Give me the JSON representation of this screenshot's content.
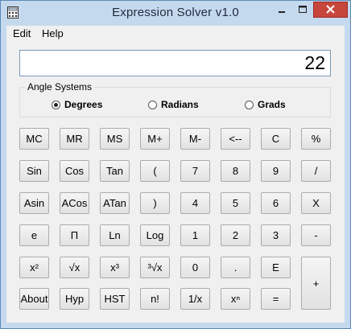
{
  "window": {
    "title": "Expression Solver v1.0"
  },
  "menu": [
    "Edit",
    "Help"
  ],
  "display": {
    "value": "22"
  },
  "angle_systems": {
    "label": "Angle Systems",
    "options": [
      {
        "label": "Degrees",
        "selected": true
      },
      {
        "label": "Radians",
        "selected": false
      },
      {
        "label": "Grads",
        "selected": false
      }
    ]
  },
  "buttons": {
    "rows": [
      [
        "MC",
        "MR",
        "MS",
        "M+",
        "M-",
        "<--",
        "C",
        "%"
      ],
      [
        "Sin",
        "Cos",
        "Tan",
        "(",
        "7",
        "8",
        "9",
        "/"
      ],
      [
        "Asin",
        "ACos",
        "ATan",
        ")",
        "4",
        "5",
        "6",
        "X"
      ],
      [
        "e",
        "Π",
        "Ln",
        "Log",
        "1",
        "2",
        "3",
        "-"
      ],
      [
        "x²",
        "√x",
        "x³",
        "³√x",
        "0",
        ".",
        "E"
      ],
      [
        "About",
        "Hyp",
        "HST",
        "n!",
        "1/x",
        "xⁿ",
        "="
      ]
    ],
    "plus": "+"
  },
  "colors": {
    "close_button": "#c7463c",
    "titlebar": "#c5d9ee",
    "client": "#f0f0f0"
  }
}
